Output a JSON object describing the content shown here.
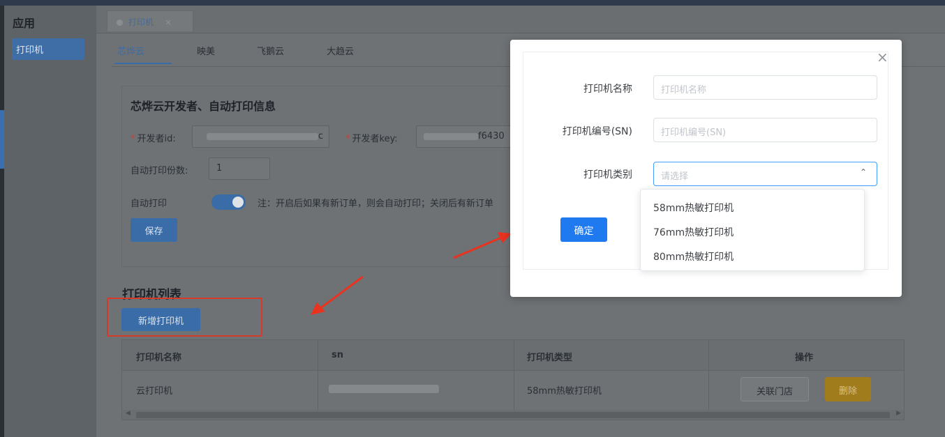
{
  "sidebar": {
    "title": "应用",
    "items": [
      {
        "label": "打印机"
      }
    ]
  },
  "tabs": [
    {
      "label": "打印机",
      "close": "×"
    }
  ],
  "subtabs": [
    "芯烨云",
    "映美",
    "飞鹅云",
    "大趋云"
  ],
  "dev_panel": {
    "title": "芯烨云开发者、自动打印信息",
    "dev_id_label": "开发者id:",
    "dev_id_visible_end": "c",
    "dev_key_label": "开发者key:",
    "dev_key_visible": "f6430",
    "copies_label": "自动打印份数:",
    "copies_value": "1",
    "auto_print_label": "自动打印",
    "auto_print_on": true,
    "note": "注：开启后如果有新订单，则会自动打印；关闭后有新订单",
    "save_label": "保存"
  },
  "printer_list": {
    "title": "打印机列表",
    "add_label": "新增打印机",
    "columns": [
      "打印机名称",
      "sn",
      "打印机类型",
      "操作"
    ],
    "rows": [
      {
        "name": "云打印机",
        "type": "58mm热敏打印机",
        "link_label": "关联门店",
        "delete_label": "删除"
      }
    ]
  },
  "modal": {
    "name_label": "打印机名称",
    "name_placeholder": "打印机名称",
    "sn_label": "打印机编号(SN)",
    "sn_placeholder": "打印机编号(SN)",
    "type_label": "打印机类别",
    "type_placeholder": "请选择",
    "ok_label": "确定",
    "close": "×",
    "options": [
      "58mm热敏打印机",
      "76mm热敏打印机",
      "80mm热敏打印机"
    ]
  },
  "colors": {
    "primary": "#1f7af0",
    "annotation": "#d83a2a",
    "delete": "#e6a23c"
  }
}
